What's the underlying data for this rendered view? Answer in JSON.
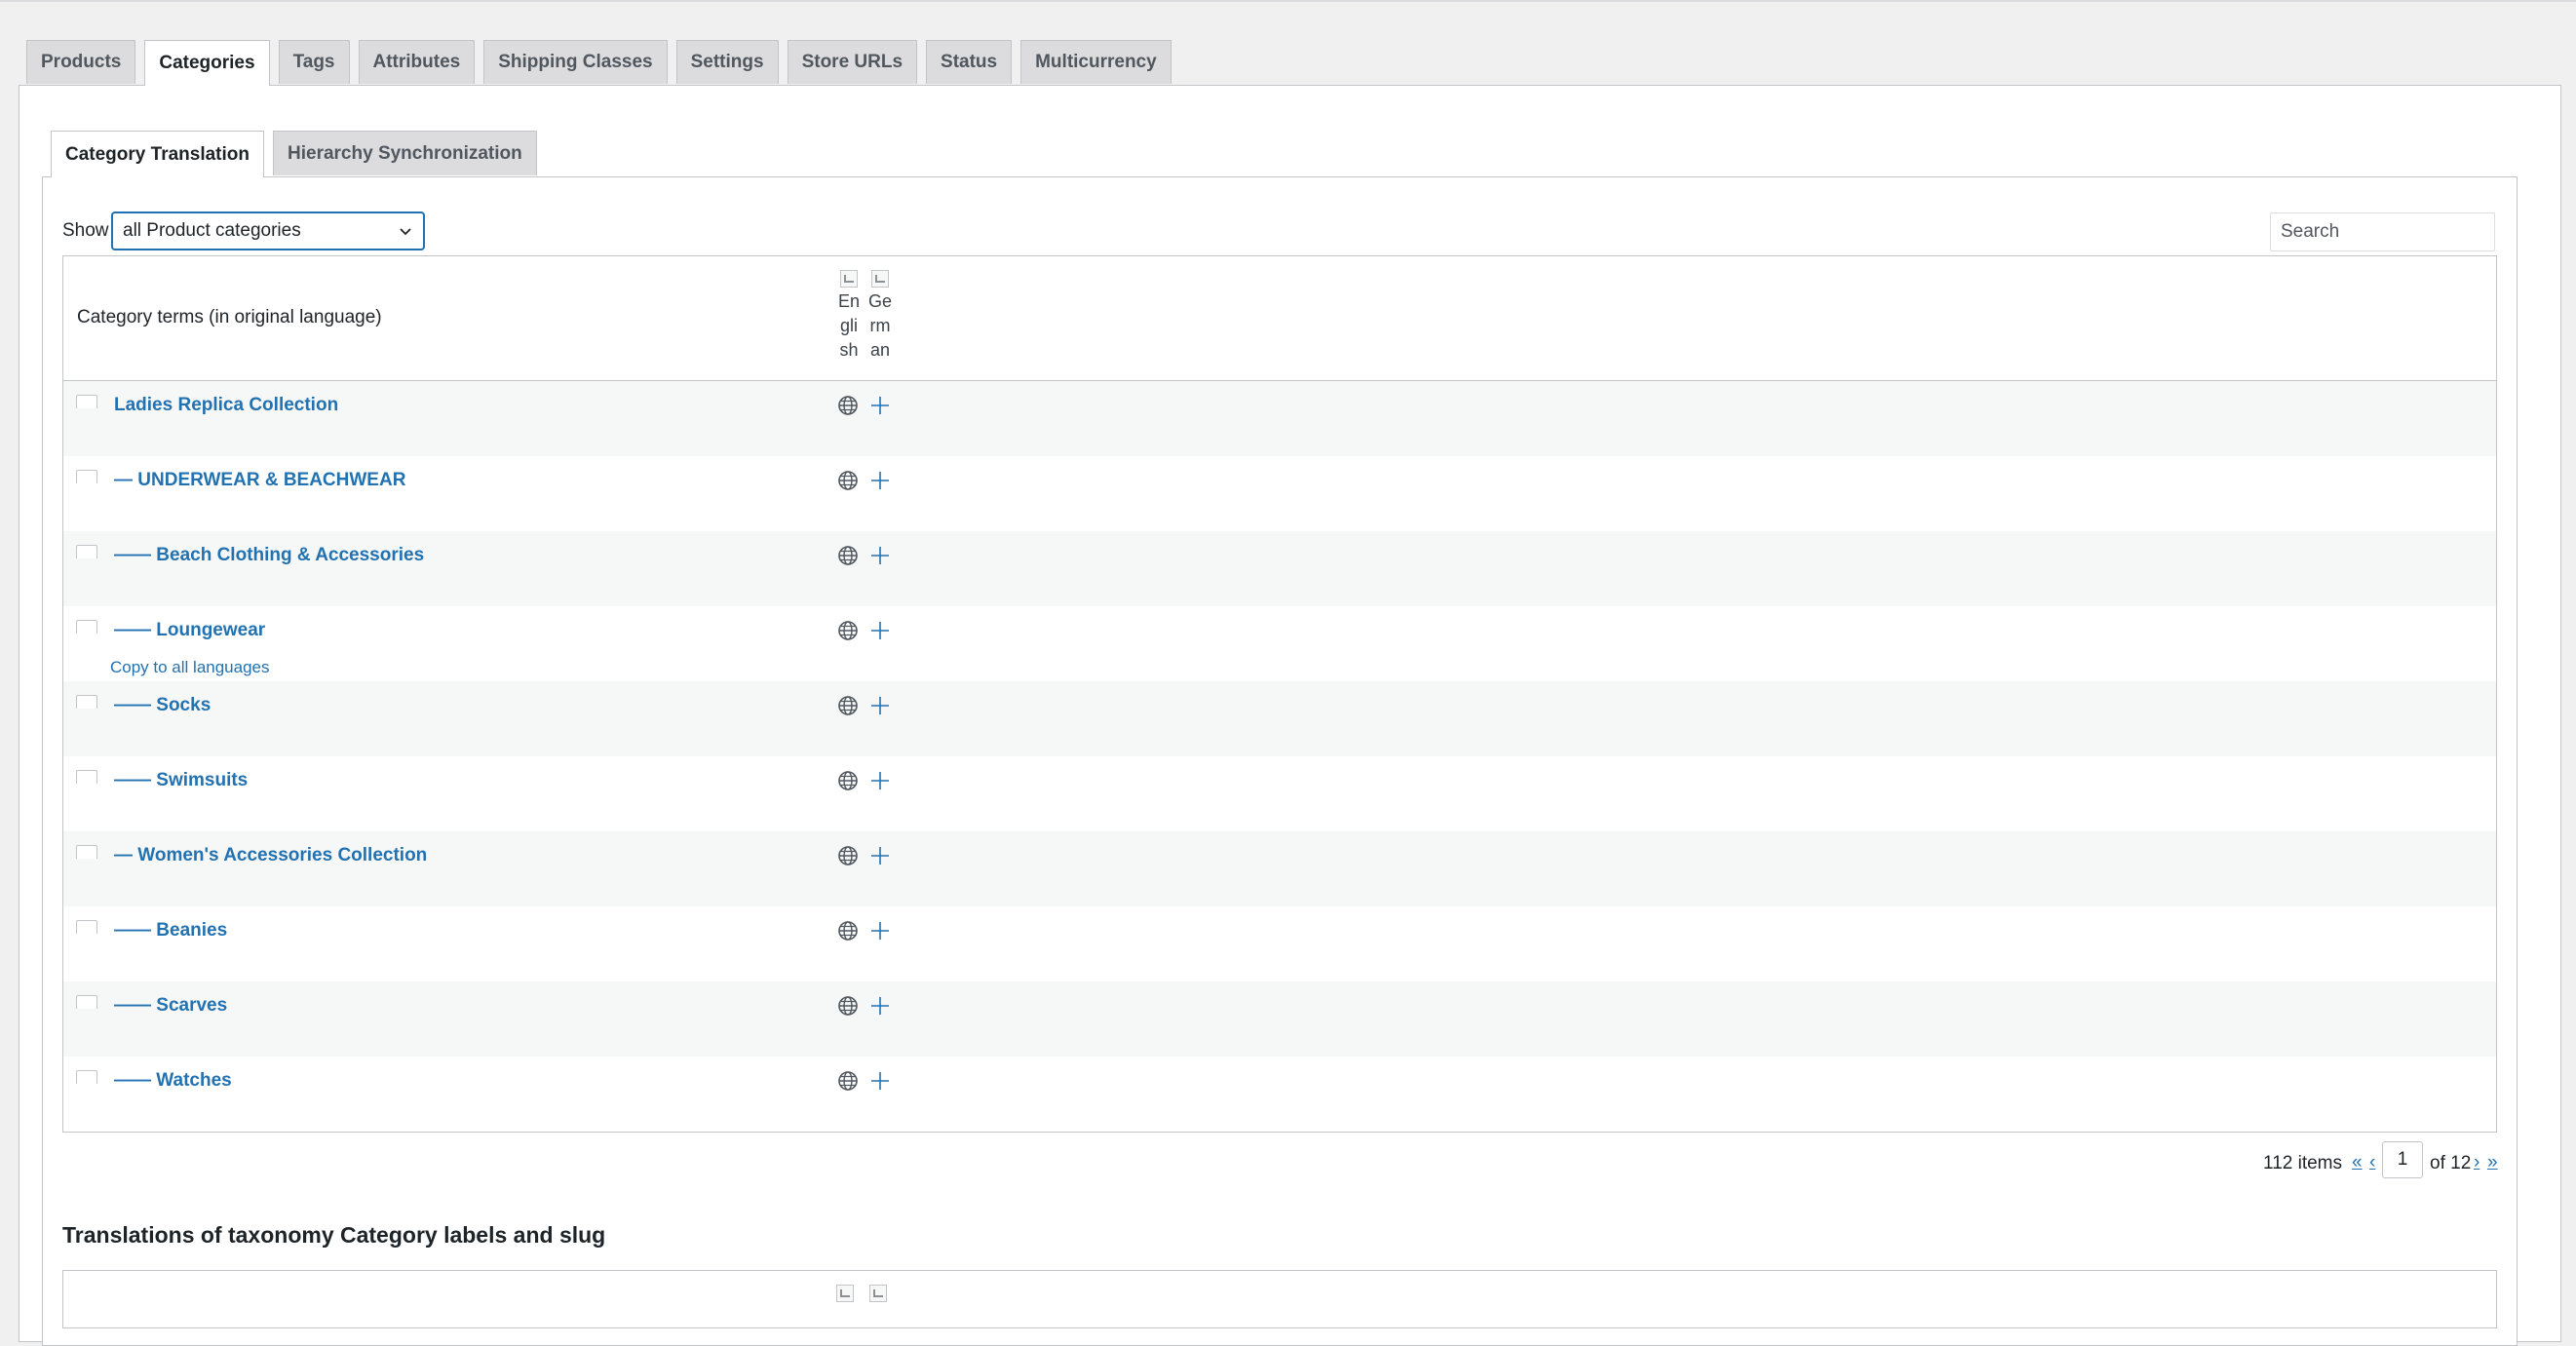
{
  "main_tabs": [
    "Products",
    "Categories",
    "Tags",
    "Attributes",
    "Shipping Classes",
    "Settings",
    "Store URLs",
    "Status",
    "Multicurrency"
  ],
  "sub_tabs": [
    "Category Translation",
    "Hierarchy Synchronization"
  ],
  "filter": {
    "show_label": "Show",
    "selected": "all Product categories",
    "search_placeholder": "Search"
  },
  "table": {
    "header_label": "Category terms (in original language)",
    "languages": [
      "English",
      "German"
    ],
    "rows": [
      {
        "name": "Ladies Replica Collection"
      },
      {
        "name": "— UNDERWEAR & BEACHWEAR"
      },
      {
        "name": "—— Beach Clothing & Accessories"
      },
      {
        "name": "—— Loungewear",
        "action": "Copy to all languages"
      },
      {
        "name": "—— Socks"
      },
      {
        "name": "—— Swimsuits"
      },
      {
        "name": "— Women's Accessories Collection"
      },
      {
        "name": "—— Beanies"
      },
      {
        "name": "—— Scarves"
      },
      {
        "name": "—— Watches"
      }
    ]
  },
  "pagination": {
    "count": "112 items",
    "first": "«",
    "prev": "‹",
    "current": "1",
    "of_text": "of 12",
    "next": "›",
    "last": "»"
  },
  "labels_section": {
    "title": "Translations of taxonomy Category labels and slug"
  },
  "colors": {
    "link": "#2271b1",
    "tab_bg": "#dcdcde",
    "border": "#c3c4c7",
    "row_alt": "#f6f7f7"
  },
  "icons": {
    "translation_status": "globe-icon",
    "add_translation": "plus-icon"
  }
}
